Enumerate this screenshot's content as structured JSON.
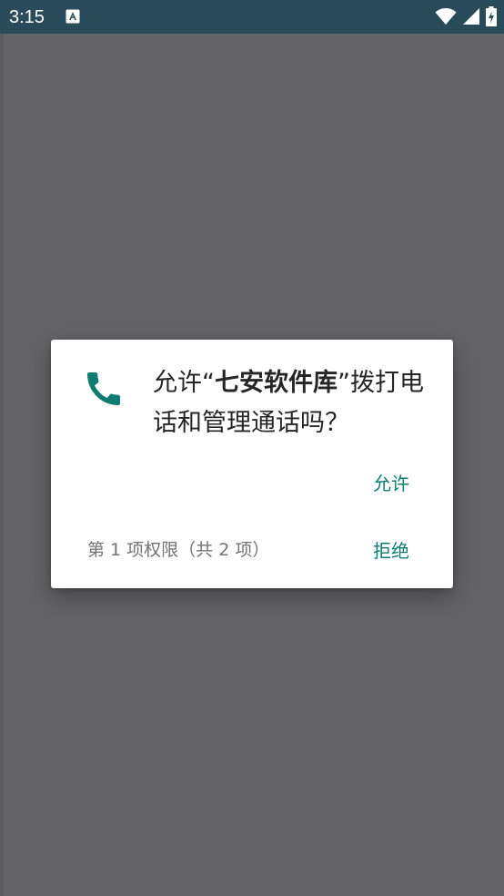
{
  "status_bar": {
    "time": "3:15",
    "notification_icon": "app-notification-icon",
    "icons": [
      "wifi-icon",
      "cellular-signal-icon",
      "battery-charging-icon"
    ]
  },
  "colors": {
    "status_bar": "#2a4c5a",
    "scrim": "#646466",
    "dialog_background": "#ffffff",
    "accent": "#0f7c72",
    "message_text": "#262626",
    "secondary_text": "#737373"
  },
  "dialog": {
    "icon": "phone-icon",
    "message_prefix": "允许“",
    "app_name": "七安软件库",
    "message_suffix": "”拨打电话和管理通话吗？",
    "allow_label": "允许",
    "permission_counter": "第 1 项权限（共 2 项）",
    "deny_label": "拒绝"
  }
}
